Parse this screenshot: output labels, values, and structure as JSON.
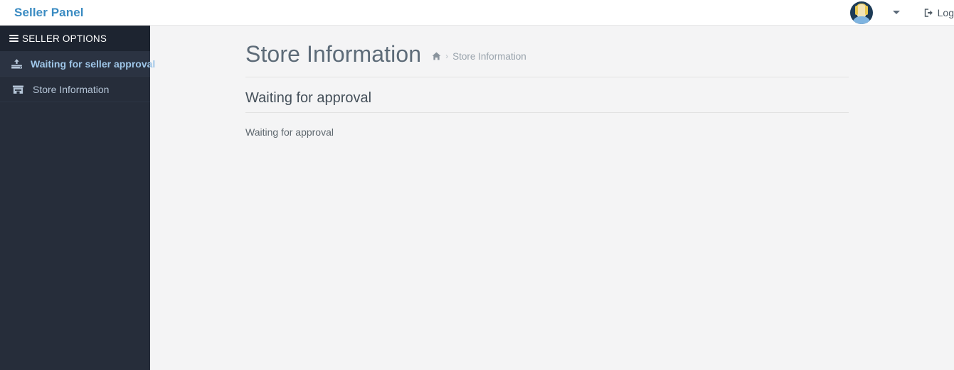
{
  "topbar": {
    "brand": "Seller Panel",
    "avatar_name": "user-avatar",
    "caret_icon": "chevron-down-icon",
    "logout_icon": "sign-out-icon",
    "logout_label": "Log",
    "background": "#ffffff",
    "brand_color": "#3a8bc2"
  },
  "sidebar": {
    "header_label": "SELLER OPTIONS",
    "header_icon": "hamburger-icon",
    "background": "#262d3a",
    "header_background": "#1d2430",
    "active_background": "#2b3342",
    "items": [
      {
        "label": "Waiting for seller approval",
        "icon": "upload-icon",
        "active": true
      },
      {
        "label": "Store Information",
        "icon": "store-icon",
        "active": false
      }
    ]
  },
  "main": {
    "page_title": "Store Information",
    "breadcrumb": {
      "home_icon": "home-icon",
      "separator": "›",
      "current": "Store Information"
    },
    "section_title": "Waiting for approval",
    "section_body": "Waiting for approval",
    "background": "#f4f4f5",
    "divider_color": "#e2e2e2"
  }
}
